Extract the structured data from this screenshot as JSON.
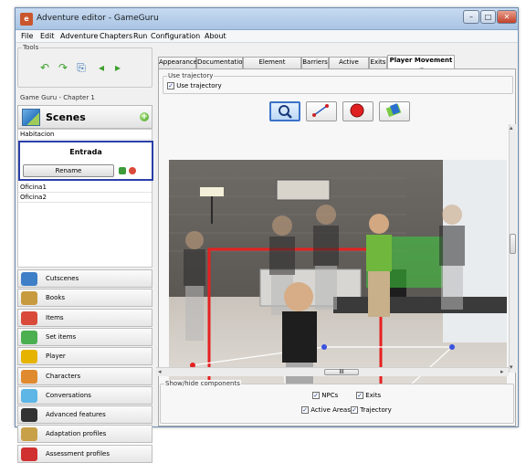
{
  "window": {
    "title": "Adventure editor - GameGuru",
    "app_icon_letter": "e"
  },
  "menu": [
    "File",
    "Edit",
    "Adventure",
    "Chapters",
    "Run",
    "Configuration",
    "About"
  ],
  "tools": {
    "legend": "Tools"
  },
  "chapter_label": "Game Guru - Chapter 1",
  "scenes": {
    "header": "Scenes",
    "items": [
      "Habitacion",
      "Entrada",
      "Oficina1",
      "Oficina2"
    ],
    "selected": "Entrada",
    "rename_label": "Rename"
  },
  "categories": [
    {
      "label": "Cutscenes",
      "icon": "cutscenes-icon",
      "color": "#3f7fc8"
    },
    {
      "label": "Books",
      "icon": "books-icon",
      "color": "#c89a3f"
    },
    {
      "label": "Items",
      "icon": "items-icon",
      "color": "#d94a3a"
    },
    {
      "label": "Set items",
      "icon": "set-items-icon",
      "color": "#4caf50"
    },
    {
      "label": "Player",
      "icon": "player-icon",
      "color": "#e6b400"
    },
    {
      "label": "Characters",
      "icon": "characters-icon",
      "color": "#e08a30"
    },
    {
      "label": "Conversations",
      "icon": "conversations-icon",
      "color": "#5db6e6"
    },
    {
      "label": "Advanced features",
      "icon": "advanced-features-icon",
      "color": "#333333"
    },
    {
      "label": "Adaptation profiles",
      "icon": "adaptation-profiles-icon",
      "color": "#c8a048"
    },
    {
      "label": "Assessment profiles",
      "icon": "assessment-profiles-icon",
      "color": "#d03030"
    }
  ],
  "tabs": [
    "Appearance",
    "Documentation",
    "Element references",
    "Barriers",
    "Active areas",
    "Exits",
    "Player Movement"
  ],
  "active_tab": "Player Movement",
  "trajectory": {
    "group_label": "Use trajectory",
    "checkbox_label": "Use trajectory",
    "checked": true
  },
  "toolbar_tools": [
    {
      "name": "zoom-icon",
      "selected": true
    },
    {
      "name": "draw-line-icon",
      "selected": false
    },
    {
      "name": "add-node-icon",
      "selected": false
    },
    {
      "name": "eraser-icon",
      "selected": false
    }
  ],
  "components": {
    "group_label": "Show/hide components",
    "npcs": "NPCs",
    "exits": "Exits",
    "active_areas": "Active Areas",
    "trajectory": "Trajectory"
  },
  "h_scroll_grip": "III",
  "colors": {
    "accent": "#2a3fa8",
    "trajectory": "#e52020",
    "exit_zone": "#3ecf3e",
    "barrier": "#e52020"
  }
}
